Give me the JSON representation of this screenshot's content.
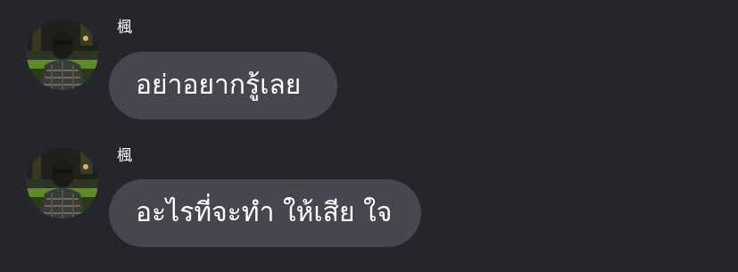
{
  "conversation": {
    "messages": [
      {
        "sender": "楓",
        "avatar": "avatar-photo",
        "text": "อย่าอยากรู้เลย"
      },
      {
        "sender": "楓",
        "avatar": "avatar-photo",
        "text": "อะไรที่จะทำ ให้เสีย ใจ"
      }
    ]
  },
  "colors": {
    "background": "#25252b",
    "bubble": "#46464e",
    "text": "#ffffff"
  }
}
